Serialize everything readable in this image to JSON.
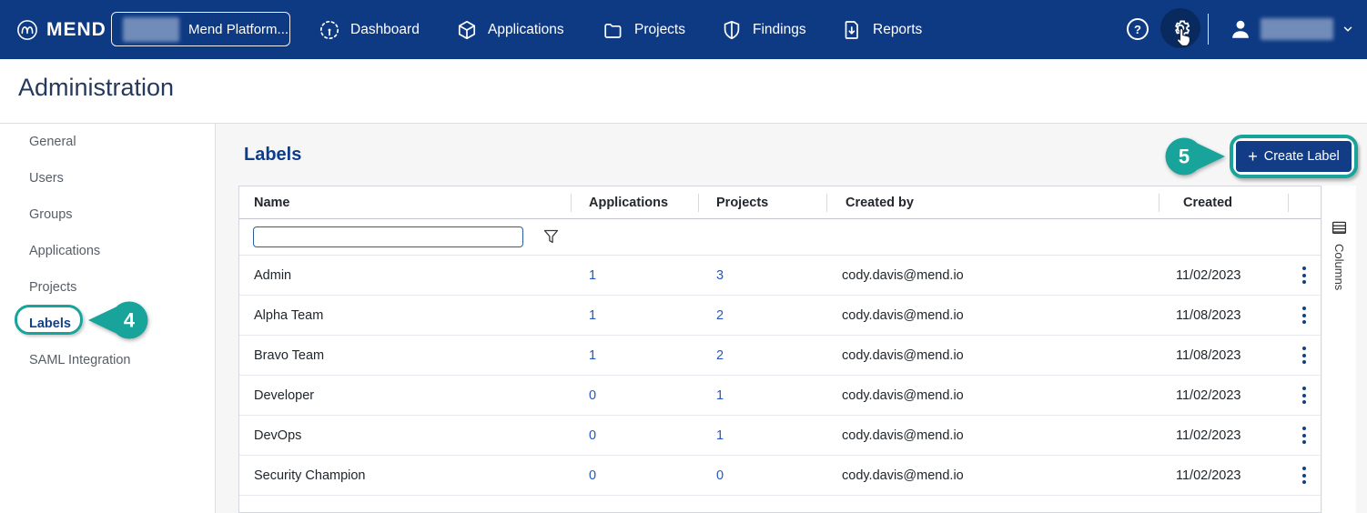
{
  "colors": {
    "navbar": "#0e3a84",
    "accent_teal": "#18a39b",
    "brand_blue": "#123c85",
    "link_blue": "#2257c4"
  },
  "nav": {
    "brand": "MEND",
    "workspace_label": "Mend Platform...",
    "items": [
      {
        "label": "Dashboard",
        "icon": "gauge-icon"
      },
      {
        "label": "Applications",
        "icon": "cube-icon"
      },
      {
        "label": "Projects",
        "icon": "folder-icon"
      },
      {
        "label": "Findings",
        "icon": "shield-icon"
      },
      {
        "label": "Reports",
        "icon": "report-icon"
      }
    ]
  },
  "page": {
    "title": "Administration"
  },
  "sidebar": {
    "items": [
      {
        "label": "General"
      },
      {
        "label": "Users"
      },
      {
        "label": "Groups"
      },
      {
        "label": "Applications"
      },
      {
        "label": "Projects"
      },
      {
        "label": "Labels",
        "active": true
      },
      {
        "label": "SAML Integration"
      }
    ]
  },
  "main": {
    "heading": "Labels",
    "create_button": {
      "plus": "+",
      "label": "Create Label"
    },
    "columns_panel_label": "Columns",
    "table": {
      "headers": [
        "Name",
        "Applications",
        "Projects",
        "Created by",
        "Created"
      ],
      "filter": {
        "value": "",
        "placeholder": ""
      },
      "rows": [
        {
          "name": "Admin",
          "applications": "1",
          "projects": "3",
          "created_by": "cody.davis@mend.io",
          "created": "11/02/2023"
        },
        {
          "name": "Alpha Team",
          "applications": "1",
          "projects": "2",
          "created_by": "cody.davis@mend.io",
          "created": "11/08/2023"
        },
        {
          "name": "Bravo Team",
          "applications": "1",
          "projects": "2",
          "created_by": "cody.davis@mend.io",
          "created": "11/08/2023"
        },
        {
          "name": "Developer",
          "applications": "0",
          "projects": "1",
          "created_by": "cody.davis@mend.io",
          "created": "11/02/2023"
        },
        {
          "name": "DevOps",
          "applications": "0",
          "projects": "1",
          "created_by": "cody.davis@mend.io",
          "created": "11/02/2023"
        },
        {
          "name": "Security Champion",
          "applications": "0",
          "projects": "0",
          "created_by": "cody.davis@mend.io",
          "created": "11/02/2023"
        }
      ]
    }
  },
  "annotations": {
    "step_sidebar": "4",
    "step_button": "5"
  }
}
